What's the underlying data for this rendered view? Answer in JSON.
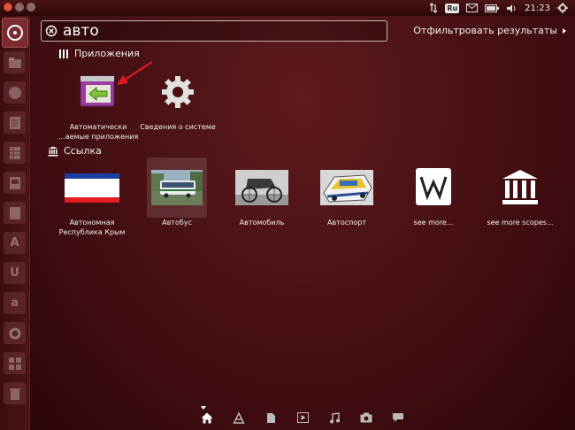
{
  "search": {
    "value": "авто"
  },
  "filter": {
    "label": "Отфильтровать результаты"
  },
  "categories": {
    "apps": "Приложения",
    "links": "Ссылка"
  },
  "apps": [
    {
      "label1": "Автоматически",
      "label2": "…аемые приложения"
    },
    {
      "label1": "Сведения о системе",
      "label2": ""
    }
  ],
  "links": [
    {
      "label1": "Автономная",
      "label2": "Республика Крым"
    },
    {
      "label1": "Автобус",
      "label2": ""
    },
    {
      "label1": "Автомобиль",
      "label2": ""
    },
    {
      "label1": "Автоспорт",
      "label2": ""
    },
    {
      "label1": "see more...",
      "label2": ""
    },
    {
      "label1": "see more scopes...",
      "label2": ""
    }
  ],
  "panel": {
    "keyboard_layout": "Ru",
    "clock": "21:23"
  },
  "launcher_letters": [
    "A",
    "U",
    "a"
  ],
  "colors": {
    "accent": "#e11b22",
    "dash_bg": "#3d0c10"
  }
}
